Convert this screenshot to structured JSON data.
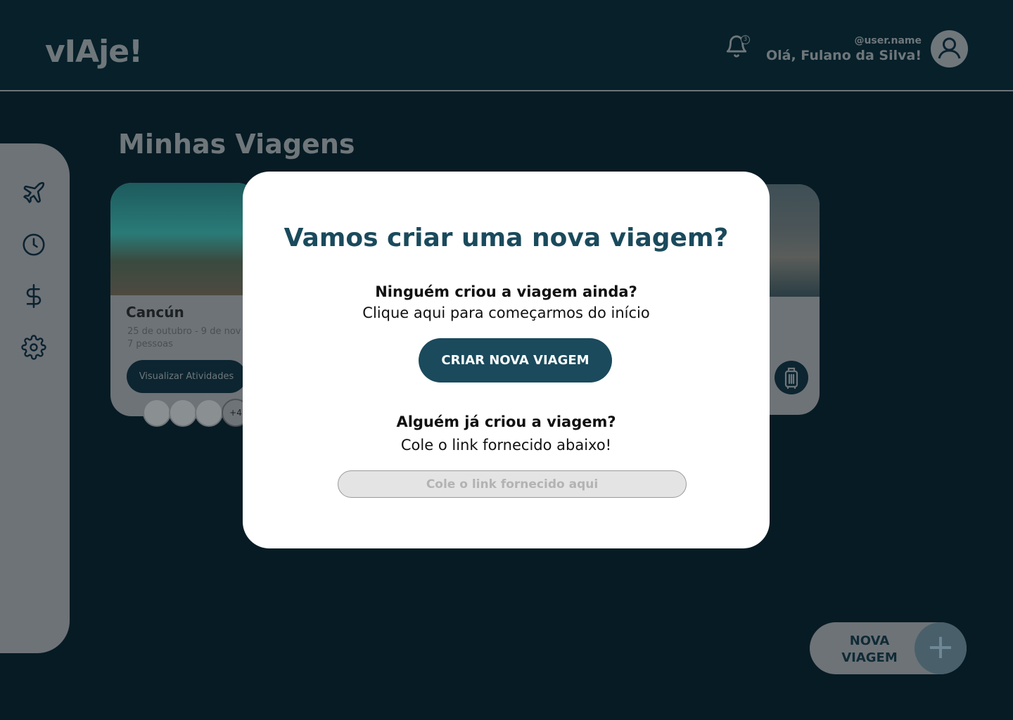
{
  "app": {
    "logo": "vIAje!"
  },
  "header": {
    "notification_count": "3",
    "user_handle": "@user.name",
    "greeting": "Olá, Fulano da Silva!"
  },
  "sidebar": {
    "items": [
      {
        "icon": "airplane-icon"
      },
      {
        "icon": "clock-icon"
      },
      {
        "icon": "dollar-icon"
      },
      {
        "icon": "gear-icon"
      }
    ]
  },
  "main": {
    "title": "Minhas Viagens",
    "trips": [
      {
        "city": "Cancún",
        "dates": "25 de outubro - 9 de nov",
        "people": "7 pessoas",
        "action_label": "Visualizar Atividades",
        "extra_members": "+4"
      }
    ]
  },
  "fab": {
    "label_line1": "NOVA",
    "label_line2": "VIAGEM",
    "plus": "+"
  },
  "modal": {
    "title": "Vamos criar uma nova viagem?",
    "question_new": "Ninguém criou a viagem ainda?",
    "subtitle_new": "Clique aqui para começarmos do início",
    "create_button": "CRIAR NOVA VIAGEM",
    "question_existing": "Alguém já criou a viagem?",
    "subtitle_existing": "Cole o link fornecido abaixo!",
    "link_input": {
      "placeholder": "Cole o link fornecido aqui",
      "value": ""
    }
  },
  "colors": {
    "overlay_background": "#071b24",
    "primary": "#1a4a5c",
    "modal_background": "#ffffff"
  }
}
